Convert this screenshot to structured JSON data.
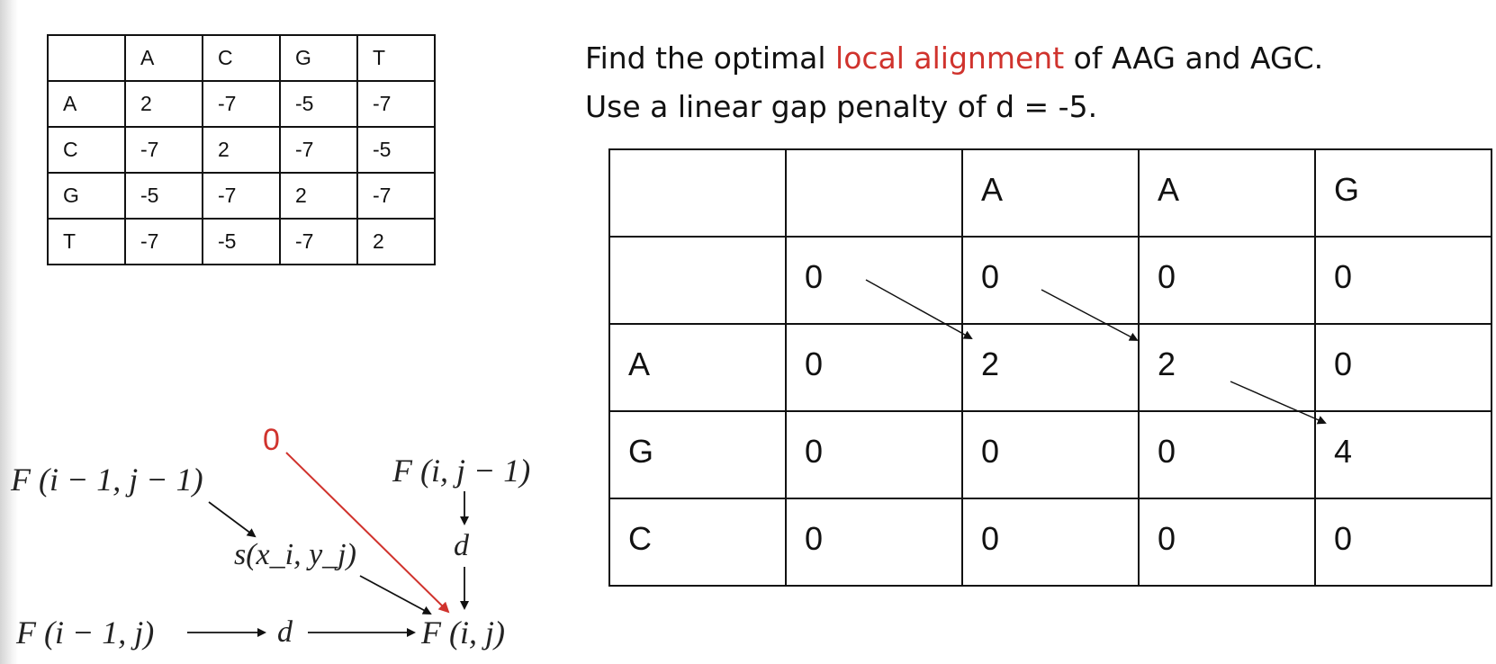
{
  "substitution_matrix": {
    "header": [
      "",
      "A",
      "C",
      "G",
      "T"
    ],
    "rows": [
      [
        "A",
        "2",
        "-7",
        "-5",
        "-7"
      ],
      [
        "C",
        "-7",
        "2",
        "-7",
        "-5"
      ],
      [
        "G",
        "-5",
        "-7",
        "2",
        "-7"
      ],
      [
        "T",
        "-7",
        "-5",
        "-7",
        "2"
      ]
    ]
  },
  "problem": {
    "line1_pre": "Find the optimal ",
    "line1_highlight": "local alignment",
    "line1_post": " of AAG and AGC.",
    "line2": "Use a linear gap penalty of d = -5.",
    "highlight_color": "#d0332d"
  },
  "dp_matrix": {
    "header": [
      "",
      "",
      "A",
      "A",
      "G"
    ],
    "rows": [
      [
        "",
        "0",
        "0",
        "0",
        "0"
      ],
      [
        "A",
        "0",
        "2",
        "2",
        "0"
      ],
      [
        "G",
        "0",
        "0",
        "0",
        "4"
      ],
      [
        "C",
        "0",
        "0",
        "0",
        "0"
      ]
    ],
    "traceback_arrows": [
      {
        "from": [
          0,
          0
        ],
        "to": [
          1,
          1
        ]
      },
      {
        "from": [
          0,
          1
        ],
        "to": [
          1,
          2
        ]
      },
      {
        "from": [
          1,
          2
        ],
        "to": [
          2,
          3
        ]
      }
    ]
  },
  "recurrence": {
    "zero": "0",
    "diag": "F (i − 1, j − 1)",
    "left": "F (i, j − 1)",
    "up": "F (i − 1, j)",
    "score": "s(x_i, y_j)",
    "gap_top": "d",
    "gap_left": "d",
    "target": "F (i, j)",
    "zero_color": "#d0332d"
  }
}
